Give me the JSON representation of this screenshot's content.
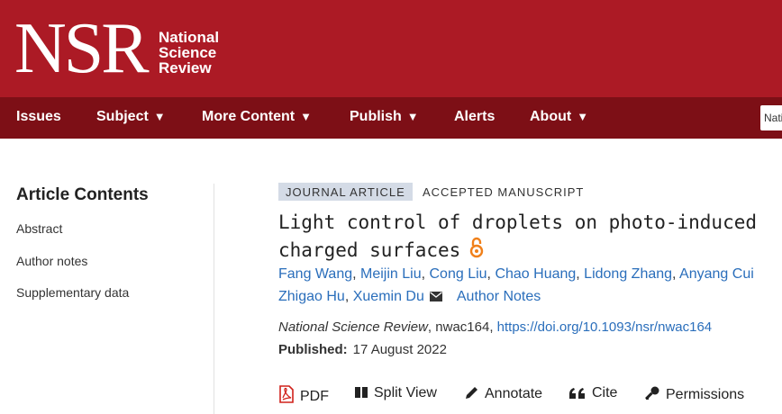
{
  "header": {
    "logo": "NSR",
    "logo_lines": [
      "National",
      "Science",
      "Review"
    ],
    "search_value": "Nati"
  },
  "nav": [
    {
      "label": "Issues",
      "has_caret": false
    },
    {
      "label": "Subject",
      "has_caret": true
    },
    {
      "label": "More Content",
      "has_caret": true
    },
    {
      "label": "Publish",
      "has_caret": true
    },
    {
      "label": "Alerts",
      "has_caret": false
    },
    {
      "label": "About",
      "has_caret": true
    }
  ],
  "sidebar": {
    "title": "Article Contents",
    "items": [
      "Abstract",
      "Author notes",
      "Supplementary data"
    ]
  },
  "article": {
    "type_badge": "JOURNAL ARTICLE",
    "status": "ACCEPTED MANUSCRIPT",
    "title_lines": [
      "Light control of droplets on photo-induced",
      "charged surfaces"
    ],
    "authors_line1": [
      "Fang Wang",
      "Meijin Liu",
      "Cong Liu",
      "Chao Huang",
      "Lidong Zhang",
      "Anyang Cui"
    ],
    "authors_line2": [
      "Zhigao Hu",
      "Xuemin Du"
    ],
    "author_notes": "Author Notes",
    "journal": "National Science Review",
    "article_id": "nwac164",
    "doi": "https://doi.org/10.1093/nsr/nwac164",
    "published_label": "Published:",
    "published_date": "17 August 2022"
  },
  "tools": {
    "pdf": "PDF",
    "split_view": "Split View",
    "annotate": "Annotate",
    "cite": "Cite",
    "permissions": "Permissions"
  },
  "colors": {
    "header": "#ac1a25",
    "nav": "#7d0f16",
    "link": "#2a6ebb",
    "badge": "#d4dbe6",
    "open_access": "#f0801a"
  }
}
